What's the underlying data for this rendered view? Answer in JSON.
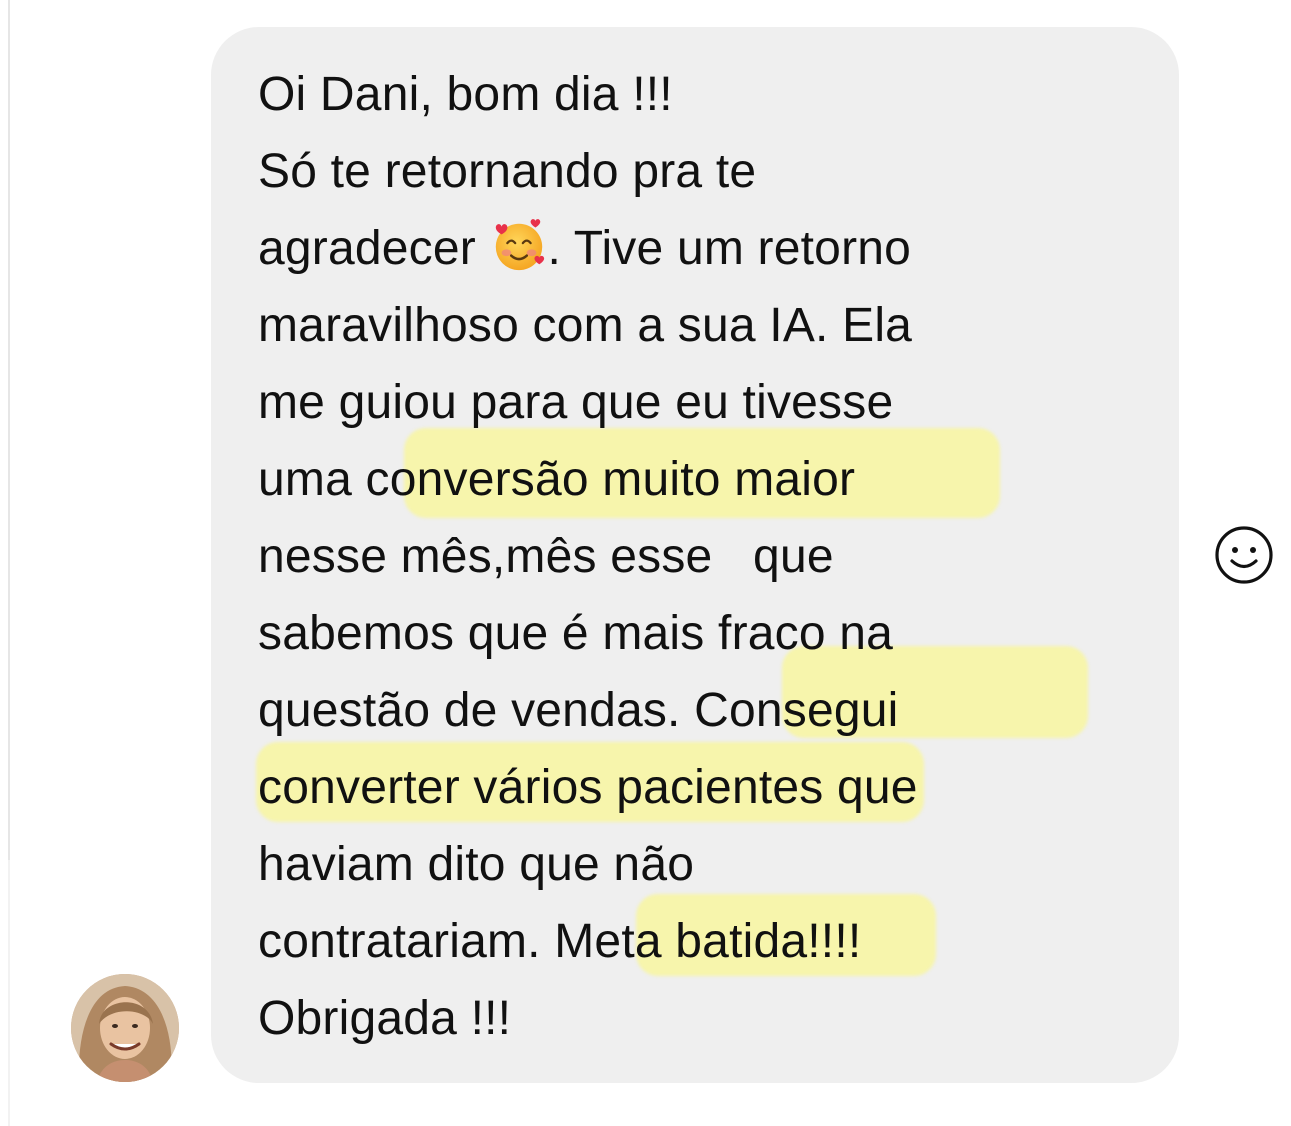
{
  "message": {
    "lines": [
      "Oi Dani, bom dia !!!",
      "Só te retornando pra te",
      "agradecer",
      ". Tive um retorno",
      "maravilhoso com a sua IA. Ela",
      "me guiou para que eu tivesse",
      "uma conversão muito maior",
      "nesse mês,mês esse   que",
      "sabemos que é mais fraco na",
      "questão de vendas. Consegui",
      "converter vários pacientes que",
      "haviam dito que não",
      "contratariam. Meta batida!!!!",
      "Obrigada !!!"
    ],
    "emoji": "smiling-face-with-hearts-icon",
    "highlight_color": "#f8f6a0",
    "bubble_color": "#efefef"
  },
  "sender": {
    "avatar": "avatar"
  },
  "actions": {
    "react_icon": "smiley-react-icon"
  }
}
